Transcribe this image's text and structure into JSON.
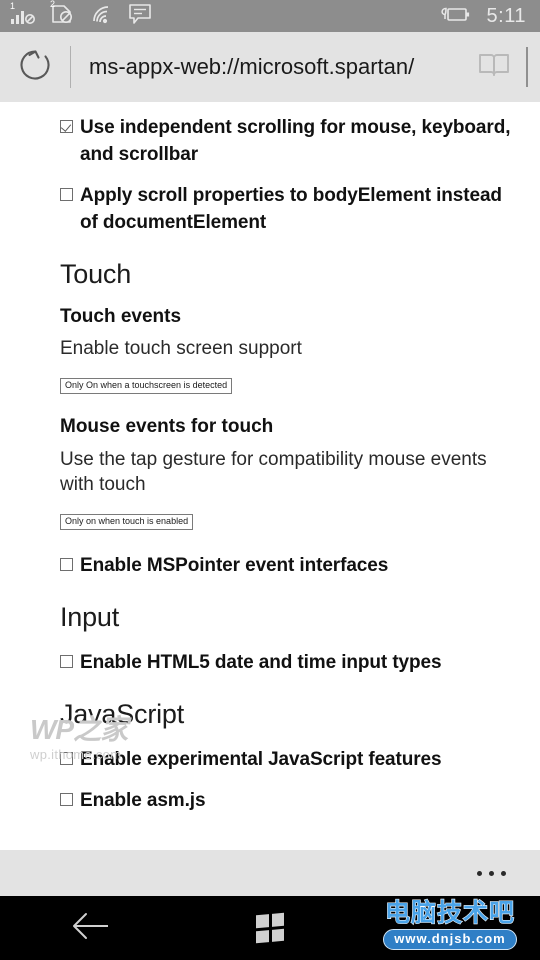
{
  "status_bar": {
    "signal_icon": "signal-bars-icon",
    "signal_sup": "1",
    "sim2_icon": "sim-no-service-icon",
    "sim2_sup": "2",
    "wifi_icon": "wifi-icon",
    "message_icon": "message-icon",
    "battery_icon": "battery-saver-icon",
    "time": "5:11",
    "background_color": "#8d8d8d"
  },
  "address_bar": {
    "refresh_icon": "refresh-icon",
    "url": "ms-appx-web://microsoft.spartan/",
    "reading_view_icon": "reading-view-icon",
    "background_color": "#e3e3e3"
  },
  "page": {
    "items": [
      {
        "kind": "checkbox",
        "name": "use-independent-scrolling",
        "checked": true,
        "label": "Use independent scrolling for mouse, keyboard, and scrollbar"
      },
      {
        "kind": "checkbox",
        "name": "apply-scroll-properties-bodyelement",
        "checked": false,
        "label": "Apply scroll properties to bodyElement instead of documentElement"
      },
      {
        "kind": "heading1",
        "name": "touch",
        "label": "Touch"
      },
      {
        "kind": "heading2",
        "name": "touch-events",
        "label": "Touch events"
      },
      {
        "kind": "paragraph",
        "name": "enable-touch-screen-support",
        "label": "Enable touch screen support"
      },
      {
        "kind": "select",
        "name": "touch-events-select",
        "value": "Only On when a touchscreen is detected"
      },
      {
        "kind": "heading2",
        "name": "mouse-events-for-touch",
        "label": "Mouse events for touch"
      },
      {
        "kind": "paragraph",
        "name": "tap-gesture-compatibility",
        "label": "Use the tap gesture for compatibility mouse events with touch"
      },
      {
        "kind": "select",
        "name": "mouse-events-select",
        "value": "Only on when touch is enabled"
      },
      {
        "kind": "checkbox",
        "name": "enable-mspointer-event-interfaces",
        "checked": false,
        "label": "Enable MSPointer event interfaces"
      },
      {
        "kind": "heading1",
        "name": "input",
        "label": "Input"
      },
      {
        "kind": "checkbox",
        "name": "enable-html5-date-time-input",
        "checked": false,
        "label": "Enable HTML5 date and time input types"
      },
      {
        "kind": "heading1",
        "name": "javascript",
        "label": "JavaScript"
      },
      {
        "kind": "checkbox",
        "name": "enable-experimental-javascript-features",
        "checked": false,
        "label": "Enable experimental JavaScript features"
      },
      {
        "kind": "checkbox",
        "name": "enable-asm-js",
        "checked": false,
        "label": "Enable asm.js"
      }
    ]
  },
  "page_watermark": {
    "main": "WP之家",
    "sub": "wp.ithome.com"
  },
  "browser_toolbar": {
    "more_icon": "more-ellipsis-icon",
    "background_color": "#e3e3e3"
  },
  "nav_bar": {
    "back_icon": "back-arrow-icon",
    "start_icon": "windows-start-icon",
    "background_color": "#000000"
  },
  "nav_watermark": {
    "cn": "电脑技术吧",
    "url": "www.dnjsb.com",
    "color": "#4aa3e8",
    "pill_color": "#2f7fc6"
  }
}
